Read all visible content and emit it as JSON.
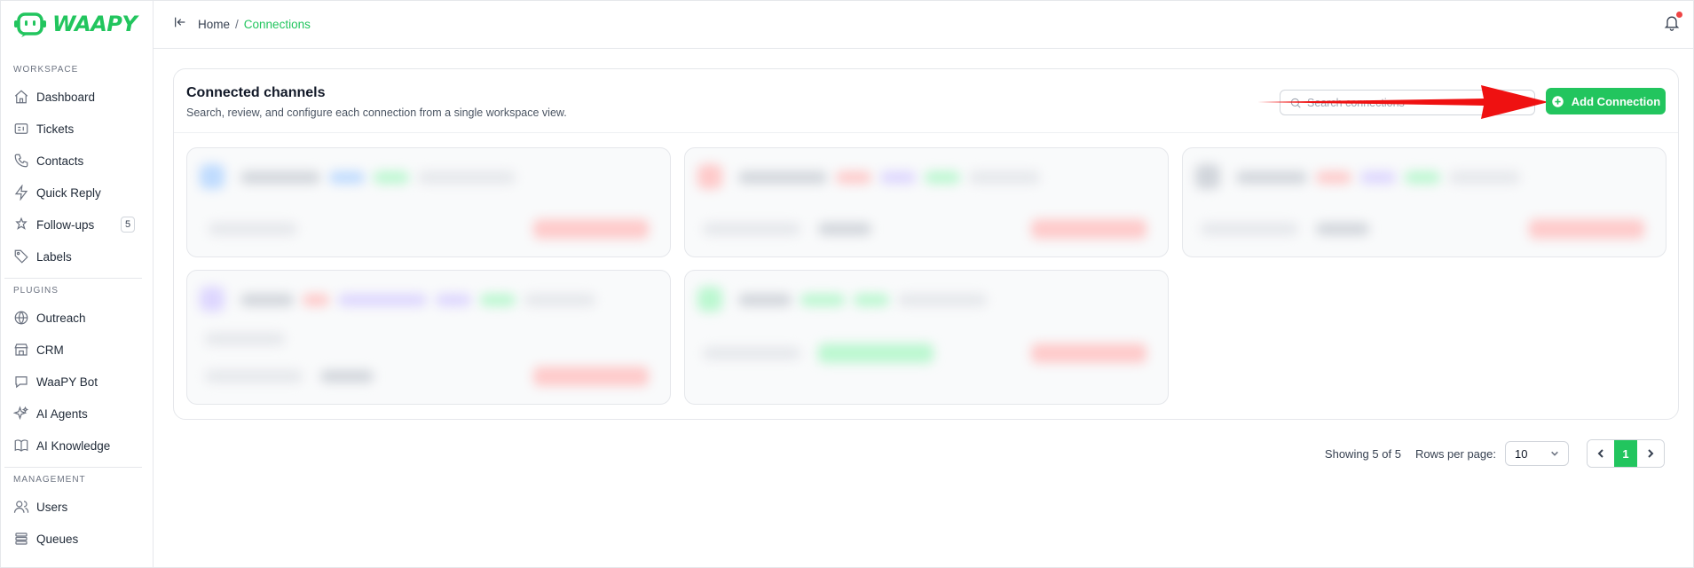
{
  "brand": {
    "name": "WAAPY",
    "accent": "#22c55e"
  },
  "sidebar": {
    "sections": [
      {
        "label": "WORKSPACE",
        "items": [
          {
            "label": "Dashboard",
            "icon": "home-icon"
          },
          {
            "label": "Tickets",
            "icon": "ticket-icon"
          },
          {
            "label": "Contacts",
            "icon": "phone-icon"
          },
          {
            "label": "Quick Reply",
            "icon": "bolt-icon"
          },
          {
            "label": "Follow-ups",
            "icon": "follow-up-icon",
            "badge": "5"
          },
          {
            "label": "Labels",
            "icon": "tag-icon"
          }
        ]
      },
      {
        "label": "PLUGINS",
        "items": [
          {
            "label": "Outreach",
            "icon": "globe-icon"
          },
          {
            "label": "CRM",
            "icon": "store-icon"
          },
          {
            "label": "WaaPY Bot",
            "icon": "chat-bot-icon"
          },
          {
            "label": "AI Agents",
            "icon": "sparkles-icon"
          },
          {
            "label": "AI Knowledge",
            "icon": "book-icon"
          }
        ]
      },
      {
        "label": "MANAGEMENT",
        "items": [
          {
            "label": "Users",
            "icon": "users-icon"
          },
          {
            "label": "Queues",
            "icon": "queue-icon"
          }
        ]
      }
    ]
  },
  "topbar": {
    "breadcrumb": {
      "home": "Home",
      "separator": "/",
      "current": "Connections"
    }
  },
  "card": {
    "title": "Connected channels",
    "subtitle": "Search, review, and configure each connection from a single workspace view.",
    "search": {
      "placeholder": "Search connections",
      "value": ""
    },
    "add_button": "Add Connection"
  },
  "pagination": {
    "showing": "Showing 5 of 5",
    "rows_label": "Rows per page:",
    "rows_value": "10",
    "current_page": "1"
  },
  "colors": {
    "accent": "#22c55e",
    "annotation_arrow": "#ef1111",
    "notification_dot": "#ef4444"
  }
}
